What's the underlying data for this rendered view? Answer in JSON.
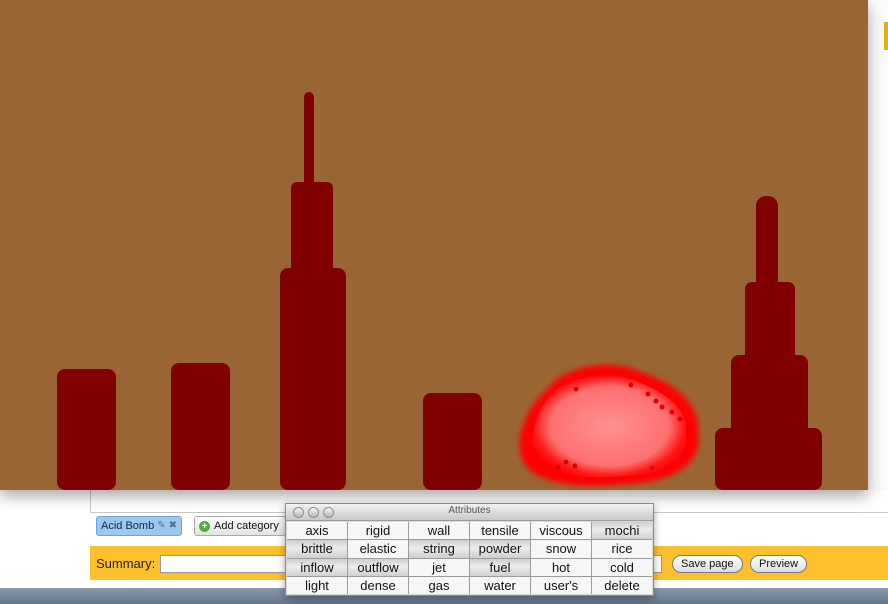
{
  "page": {
    "category_chip": "Acid Bomb",
    "add_category_label": "Add category",
    "summary_label": "Summary:",
    "summary_value": "",
    "save_label": "Save page",
    "preview_label": "Preview"
  },
  "palette": {
    "title": "Attributes",
    "attributes": [
      {
        "label": "axis",
        "on": false
      },
      {
        "label": "rigid",
        "on": false
      },
      {
        "label": "wall",
        "on": false
      },
      {
        "label": "tensile",
        "on": false
      },
      {
        "label": "viscous",
        "on": false
      },
      {
        "label": "mochi",
        "on": true
      },
      {
        "label": "brittle",
        "on": true
      },
      {
        "label": "elastic",
        "on": false
      },
      {
        "label": "string",
        "on": true
      },
      {
        "label": "powder",
        "on": true
      },
      {
        "label": "snow",
        "on": false
      },
      {
        "label": "rice",
        "on": false
      },
      {
        "label": "inflow",
        "on": true
      },
      {
        "label": "outflow",
        "on": true
      },
      {
        "label": "jet",
        "on": false
      },
      {
        "label": "fuel",
        "on": true
      },
      {
        "label": "hot",
        "on": false
      },
      {
        "label": "cold",
        "on": false
      },
      {
        "label": "light",
        "on": false
      },
      {
        "label": "dense",
        "on": false
      },
      {
        "label": "gas",
        "on": false
      },
      {
        "label": "water",
        "on": false
      },
      {
        "label": "user's",
        "on": false
      },
      {
        "label": "delete",
        "on": false
      }
    ]
  },
  "colors": {
    "canvas": "#996633",
    "structure": "#800000",
    "blob": "#ff8080",
    "blob_rim": "#ff0000",
    "summary_bar": "#fdc02d"
  }
}
